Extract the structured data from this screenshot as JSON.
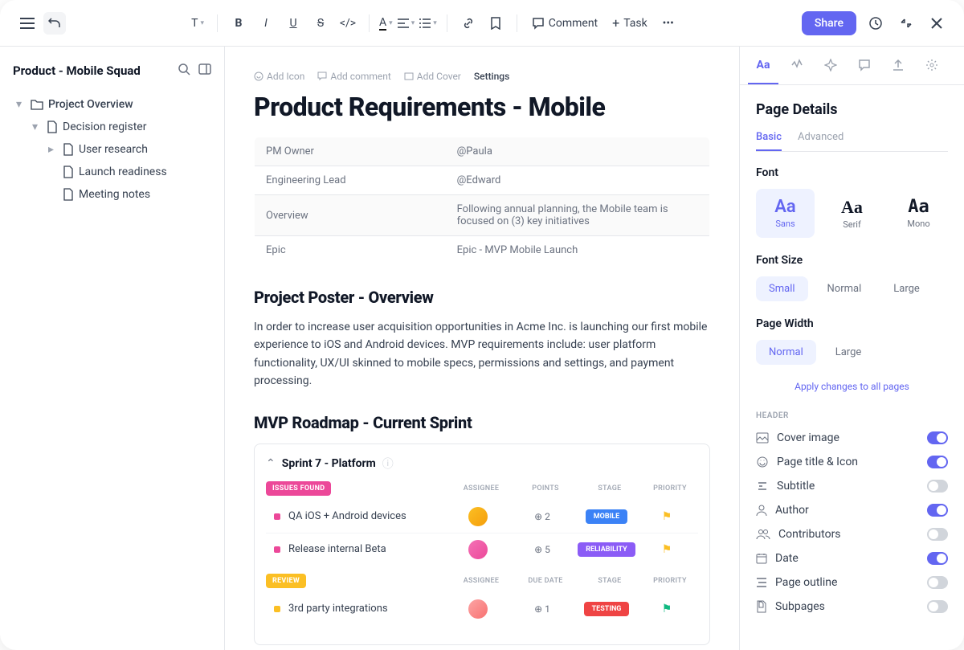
{
  "toolbar": {
    "comment": "Comment",
    "task": "Task",
    "share": "Share"
  },
  "sidebar": {
    "title": "Product - Mobile Squad",
    "tree": {
      "l1": "Project Overview",
      "l2": "Decision register",
      "l3_1": "User research",
      "l3_2": "Launch readiness",
      "l3_3": "Meeting notes"
    }
  },
  "page": {
    "actions": {
      "icon": "Add Icon",
      "comment": "Add comment",
      "cover": "Add Cover",
      "settings": "Settings"
    },
    "title": "Product Requirements - Mobile",
    "meta": [
      {
        "k": "PM Owner",
        "v": "@Paula"
      },
      {
        "k": "Engineering Lead",
        "v": "@Edward"
      },
      {
        "k": "Overview",
        "v": "Following annual planning, the Mobile team is focused on (3) key initiatives"
      },
      {
        "k": "Epic",
        "v": "Epic - MVP Mobile Launch"
      }
    ],
    "h2_1": "Project Poster - Overview",
    "body_1": "In order to increase user acquisition opportunities in Acme Inc. is launching our first mobile experience to iOS and Android devices. MVP requirements include: user platform functionality, UX/UI skinned to mobile specs, permissions and settings, and payment processing.",
    "h2_2": "MVP Roadmap - Current Sprint",
    "sprint": {
      "title": "Sprint  7 - Platform",
      "section1": {
        "status": "ISSUES FOUND",
        "cols": {
          "a": "ASSIGNEE",
          "b": "POINTS",
          "c": "STAGE",
          "d": "PRIORITY"
        },
        "tasks": [
          {
            "name": "QA iOS + Android devices",
            "points": "2",
            "stage": "MOBILE"
          },
          {
            "name": "Release internal Beta",
            "points": "5",
            "stage": "RELIABILITY"
          }
        ]
      },
      "section2": {
        "status": "REVIEW",
        "cols": {
          "a": "ASSIGNEE",
          "b": "DUE DATE",
          "c": "STAGE",
          "d": "PRIORITY"
        },
        "tasks": [
          {
            "name": "3rd party integrations",
            "points": "1",
            "stage": "TESTING"
          }
        ]
      }
    }
  },
  "panel": {
    "title": "Page Details",
    "tabs": {
      "basic": "Basic",
      "advanced": "Advanced"
    },
    "font_label": "Font",
    "fonts": [
      {
        "big": "Aa",
        "label": "Sans"
      },
      {
        "big": "Aa",
        "label": "Serif"
      },
      {
        "big": "Aa",
        "label": "Mono"
      }
    ],
    "size_label": "Font Size",
    "sizes": [
      "Small",
      "Normal",
      "Large"
    ],
    "width_label": "Page Width",
    "widths": [
      "Normal",
      "Large"
    ],
    "apply": "Apply changes to all pages",
    "header_label": "HEADER",
    "toggles": [
      {
        "label": "Cover image",
        "on": true
      },
      {
        "label": "Page title & Icon",
        "on": true
      },
      {
        "label": "Subtitle",
        "on": false
      },
      {
        "label": "Author",
        "on": true
      },
      {
        "label": "Contributors",
        "on": false
      },
      {
        "label": "Date",
        "on": true
      },
      {
        "label": "Page outline",
        "on": false
      },
      {
        "label": "Subpages",
        "on": false
      }
    ]
  }
}
